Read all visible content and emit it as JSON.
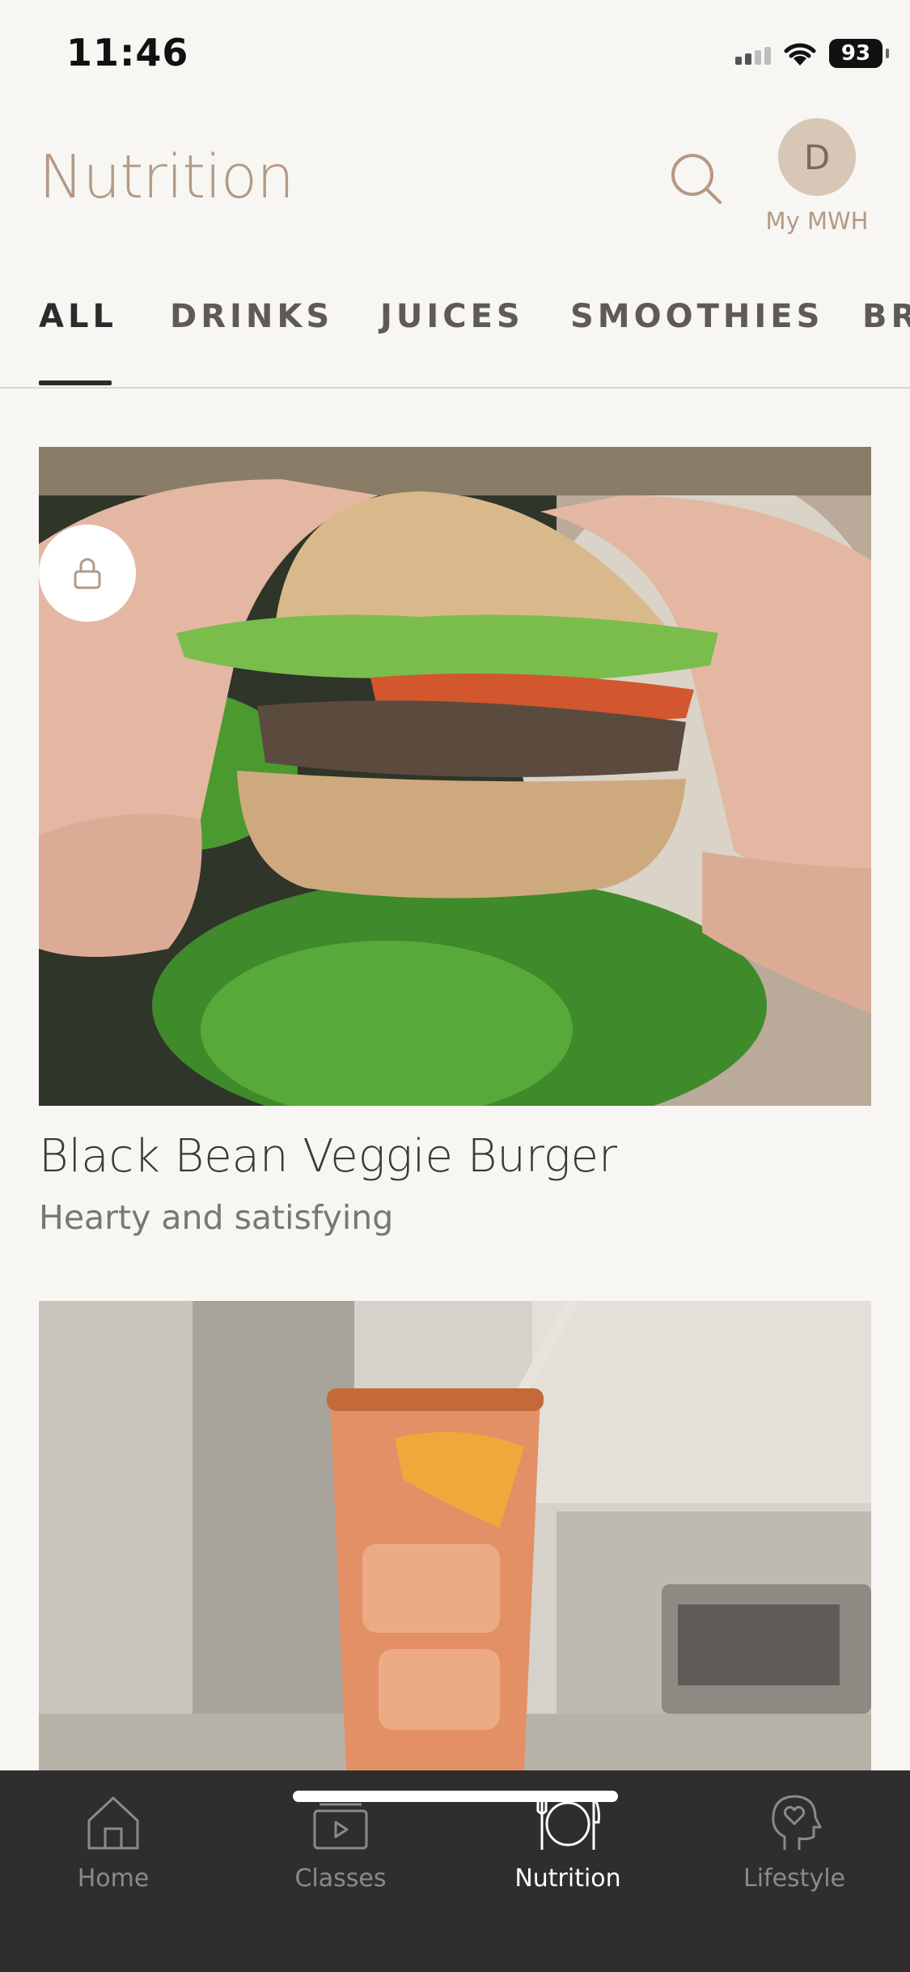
{
  "status_bar": {
    "time": "11:46",
    "battery": "93"
  },
  "header": {
    "title": "Nutrition",
    "avatar_initial": "D",
    "avatar_label": "My MWH"
  },
  "tabs": [
    {
      "label": "ALL",
      "active": true
    },
    {
      "label": "DRINKS",
      "active": false
    },
    {
      "label": "JUICES",
      "active": false
    },
    {
      "label": "SMOOTHIES",
      "active": false
    },
    {
      "label": "BR",
      "active": false
    }
  ],
  "recipes": [
    {
      "title": "Black Bean Veggie Burger",
      "subtitle": "Hearty and satisfying",
      "image_icon": "burger-photo",
      "locked": true
    },
    {
      "title": "",
      "subtitle": "",
      "image_icon": "drink-photo",
      "locked": false
    }
  ],
  "tab_bar": {
    "items": [
      {
        "label": "Home",
        "icon": "house-icon",
        "active": false
      },
      {
        "label": "Classes",
        "icon": "classes-icon",
        "active": false
      },
      {
        "label": "Nutrition",
        "icon": "plate-icon",
        "active": true
      },
      {
        "label": "Lifestyle",
        "icon": "head-heart-icon",
        "active": false
      }
    ]
  },
  "colors": {
    "accent": "#b39a86",
    "background": "#f8f6f3",
    "tabbar": "#2e2e2e"
  }
}
